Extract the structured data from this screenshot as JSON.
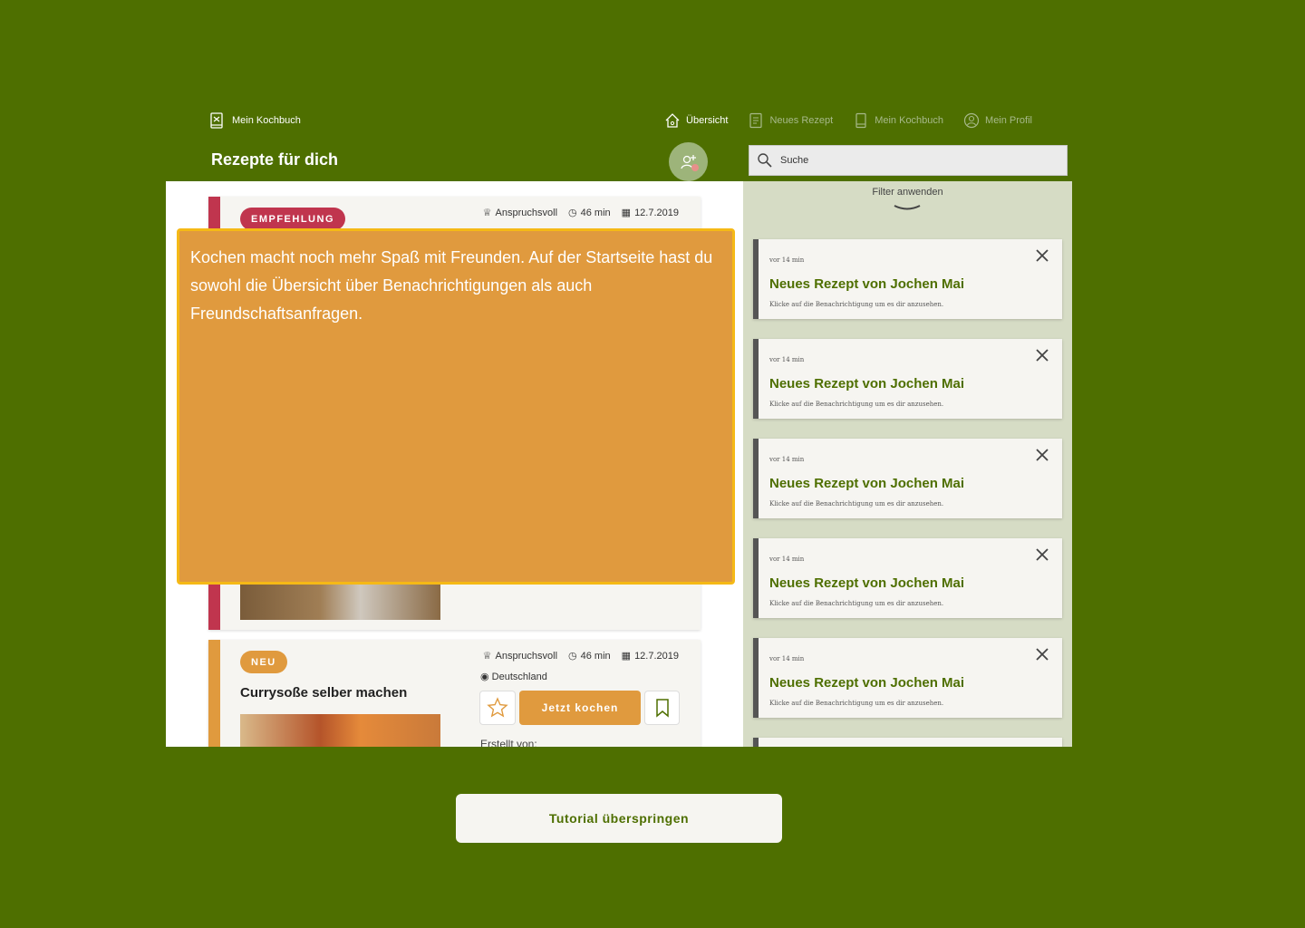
{
  "app": {
    "brand": "Mein Kochbuch",
    "page_title": "Rezepte für dich"
  },
  "nav": [
    {
      "label": "Übersicht",
      "icon": "home-icon",
      "active": true
    },
    {
      "label": "Neues Rezept",
      "icon": "document-icon",
      "active": false
    },
    {
      "label": "Mein Kochbuch",
      "icon": "book-icon",
      "active": false
    },
    {
      "label": "Mein Profil",
      "icon": "profile-icon",
      "active": false
    }
  ],
  "search": {
    "placeholder": "Suche"
  },
  "recipes": [
    {
      "badge": "EMPFEHLUNG",
      "difficulty": "Anspruchsvoll",
      "duration": "46 min",
      "date": "12.7.2019"
    },
    {
      "badge": "NEU",
      "difficulty": "Anspruchsvoll",
      "duration": "46 min",
      "date": "12.7.2019",
      "country": "Deutschland",
      "title": "Currysoße selber machen",
      "cook_label": "Jetzt kochen",
      "created_by": "Erstellt von:"
    }
  ],
  "filter": {
    "label": "Filter anwenden"
  },
  "notifications": [
    {
      "time": "vor 14 min",
      "title": "Neues Rezept von Jochen Mai",
      "desc": "Klicke auf die Benachrichtigung um es dir anzusehen."
    },
    {
      "time": "vor 14 min",
      "title": "Neues Rezept von Jochen Mai",
      "desc": "Klicke auf die Benachrichtigung um es dir anzusehen."
    },
    {
      "time": "vor 14 min",
      "title": "Neues Rezept von Jochen Mai",
      "desc": "Klicke auf die Benachrichtigung um es dir anzusehen."
    },
    {
      "time": "vor 14 min",
      "title": "Neues Rezept von Jochen Mai",
      "desc": "Klicke auf die Benachrichtigung um es dir anzusehen."
    },
    {
      "time": "vor 14 min",
      "title": "Neues Rezept von Jochen Mai",
      "desc": "Klicke auf die Benachrichtigung um es dir anzusehen."
    }
  ],
  "tutorial": {
    "text": "Kochen macht noch mehr Spaß mit Freunden. Auf der Startseite hast du sowohl die Übersicht über Benachrichtigungen als auch Freundschaftsanfragen.",
    "skip_label": "Tutorial überspringen"
  },
  "colors": {
    "background": "#4e6f00",
    "accent_orange": "#e09a3e",
    "accent_red": "#c0354e",
    "tooltip_border": "#f5b916",
    "sidebar": "#d6dcc5"
  }
}
